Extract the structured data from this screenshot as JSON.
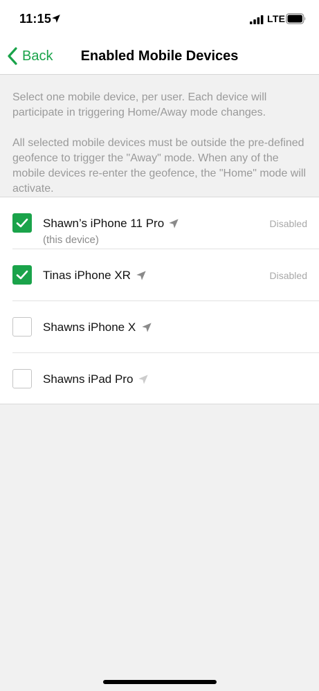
{
  "status_bar": {
    "time": "11:15",
    "network": "LTE",
    "location_icon": "location-arrow-icon",
    "signal_icon": "cellular-signal-icon",
    "battery_icon": "battery-icon"
  },
  "nav": {
    "back_label": "Back",
    "back_icon": "chevron-left-icon",
    "title": "Enabled Mobile Devices"
  },
  "description": {
    "paragraph_1": "Select one mobile device, per user. Each device will participate in triggering Home/Away mode changes.",
    "paragraph_2": "All selected mobile devices must be outside the pre-defined geofence to trigger the \"Away\" mode. When any of the mobile devices re-enter the geofence, the \"Home\" mode will activate."
  },
  "devices": [
    {
      "name": "Shawn’s iPhone 11 Pro",
      "subtitle": "(this device)",
      "checked": true,
      "status": "Disabled",
      "location_icon": "location-arrow-icon",
      "location_active": true
    },
    {
      "name": "Tinas iPhone XR",
      "subtitle": "",
      "checked": true,
      "status": "Disabled",
      "location_icon": "location-arrow-icon",
      "location_active": true
    },
    {
      "name": "Shawns iPhone X",
      "subtitle": "",
      "checked": false,
      "status": "",
      "location_icon": "location-arrow-icon",
      "location_active": true
    },
    {
      "name": "Shawns iPad Pro",
      "subtitle": "",
      "checked": false,
      "status": "",
      "location_icon": "location-arrow-icon",
      "location_active": false
    }
  ],
  "colors": {
    "accent": "#1aa34a",
    "description_text": "#9a9a9a",
    "status_text": "#a8a8a8",
    "location_icon_active": "#8a8a8a",
    "location_icon_inactive": "#cccccc"
  }
}
